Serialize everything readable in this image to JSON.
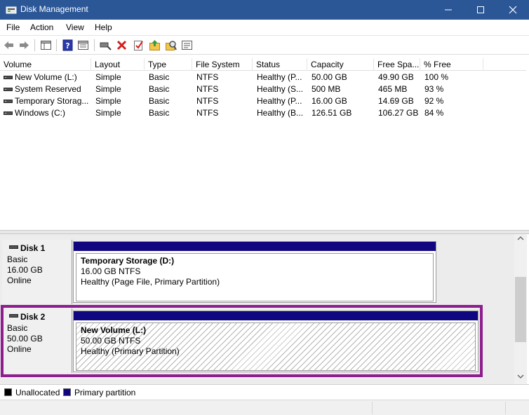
{
  "window": {
    "title": "Disk Management",
    "minimize_label": "—",
    "maximize_label": "☐",
    "close_label": "✕"
  },
  "menu": {
    "items": [
      {
        "label": "File"
      },
      {
        "label": "Action"
      },
      {
        "label": "View"
      },
      {
        "label": "Help"
      }
    ]
  },
  "toolbar": {
    "icons": [
      "back-icon",
      "forward-icon",
      "show-hide-console-tree-icon",
      "help-icon",
      "properties-icon",
      "connect-virtual-disk-icon",
      "delete-icon",
      "check-icon",
      "refresh-icon",
      "rescan-icon",
      "list-view-icon"
    ]
  },
  "volume_list": {
    "columns": [
      "Volume",
      "Layout",
      "Type",
      "File System",
      "Status",
      "Capacity",
      "Free Spa...",
      "% Free"
    ],
    "rows": [
      {
        "volume": "New Volume (L:)",
        "layout": "Simple",
        "type": "Basic",
        "fs": "NTFS",
        "status": "Healthy (P...",
        "capacity": "50.00 GB",
        "free": "49.90 GB",
        "pct": "100 %"
      },
      {
        "volume": "System Reserved",
        "layout": "Simple",
        "type": "Basic",
        "fs": "NTFS",
        "status": "Healthy (S...",
        "capacity": "500 MB",
        "free": "465 MB",
        "pct": "93 %"
      },
      {
        "volume": "Temporary Storag...",
        "layout": "Simple",
        "type": "Basic",
        "fs": "NTFS",
        "status": "Healthy (P...",
        "capacity": "16.00 GB",
        "free": "14.69 GB",
        "pct": "92 %"
      },
      {
        "volume": "Windows (C:)",
        "layout": "Simple",
        "type": "Basic",
        "fs": "NTFS",
        "status": "Healthy (B...",
        "capacity": "126.51 GB",
        "free": "106.27 GB",
        "pct": "84 %"
      }
    ]
  },
  "disks": [
    {
      "name": "Disk 1",
      "type": "Basic",
      "size": "16.00 GB",
      "state": "Online",
      "partition": {
        "title": "Temporary Storage  (D:)",
        "size_fs": "16.00 GB NTFS",
        "status": "Healthy (Page File, Primary Partition)"
      }
    },
    {
      "name": "Disk 2",
      "type": "Basic",
      "size": "50.00 GB",
      "state": "Online",
      "partition": {
        "title": "New Volume  (L:)",
        "size_fs": "50.00 GB NTFS",
        "status": "Healthy (Primary Partition)"
      }
    }
  ],
  "legend": [
    {
      "label": "Unallocated",
      "color": "#000000"
    },
    {
      "label": "Primary partition",
      "color": "#10067f"
    }
  ],
  "colors": {
    "titlebar": "#2b5797",
    "partition_bar": "#10067f",
    "highlight": "#8e1e8e"
  }
}
